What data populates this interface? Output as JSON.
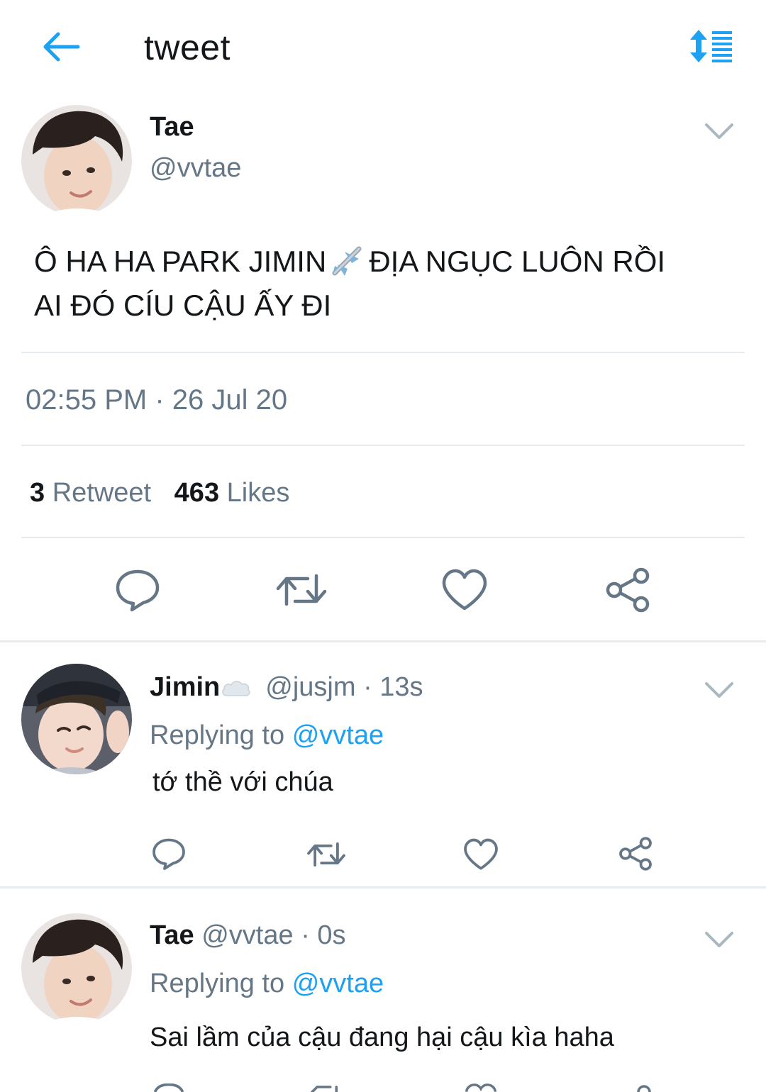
{
  "header": {
    "title": "tweet",
    "back_icon": "arrow-left-icon",
    "sort_icon": "sort-list-icon",
    "accent": "#1da1f2"
  },
  "main_tweet": {
    "name": "Tae",
    "handle": "@vvtae",
    "text_line1_a": "Ô HA HA PARK JIMIN",
    "text_line1_b": "ĐỊA NGỤC LUÔN RỒI",
    "text_line2": "AI ĐÓ CÍU CẬU ẤY ĐI",
    "emoji": "airplane-icon",
    "timestamp": "02:55 PM · 26 Jul 20",
    "retweet_count": "3",
    "retweet_label": "Retweet",
    "like_count": "463",
    "like_label": "Likes"
  },
  "replies": [
    {
      "name": "Jimin",
      "handle": "@jusjm",
      "time": "· 13s",
      "replying_label": "Replying to",
      "replying_to": "@vvtae",
      "text": "tớ thề với chúa"
    },
    {
      "name": "Tae",
      "handle": "@vvtae",
      "time": "· 0s",
      "replying_label": "Replying to",
      "replying_to": "@vvtae",
      "text": "Sai lầm của cậu đang hại cậu kìa haha"
    }
  ],
  "colors": {
    "text": "#14171a",
    "secondary": "#657786",
    "divider": "#e6ecf0",
    "link": "#1da1f2"
  }
}
